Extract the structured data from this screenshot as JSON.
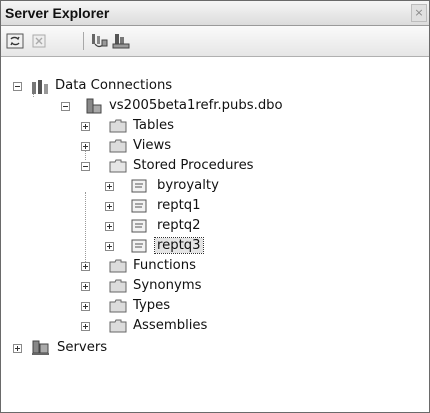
{
  "window": {
    "title": "Server Explorer",
    "close_glyph": "×"
  },
  "toolbar": {
    "buttons": [
      {
        "name": "refresh-button",
        "icon": "refresh-icon"
      },
      {
        "name": "stop-refresh-button",
        "icon": "stop-icon"
      },
      {
        "name": "connect-to-database-button",
        "icon": "connect-database-icon"
      },
      {
        "name": "connect-to-server-button",
        "icon": "connect-server-icon"
      }
    ]
  },
  "tree": {
    "data_connections": "Data Connections",
    "connection": "vs2005beta1refr.pubs.dbo",
    "tables": "Tables",
    "views": "Views",
    "stored_procedures": "Stored Procedures",
    "procedures": [
      "byroyalty",
      "reptq1",
      "reptq2",
      "reptq3"
    ],
    "selected_procedure": "reptq3",
    "functions": "Functions",
    "synonyms": "Synonyms",
    "types": "Types",
    "assemblies": "Assemblies",
    "servers": "Servers"
  },
  "colors": {
    "folder": "#d9d9d9",
    "selection": "#e4e4e4"
  }
}
